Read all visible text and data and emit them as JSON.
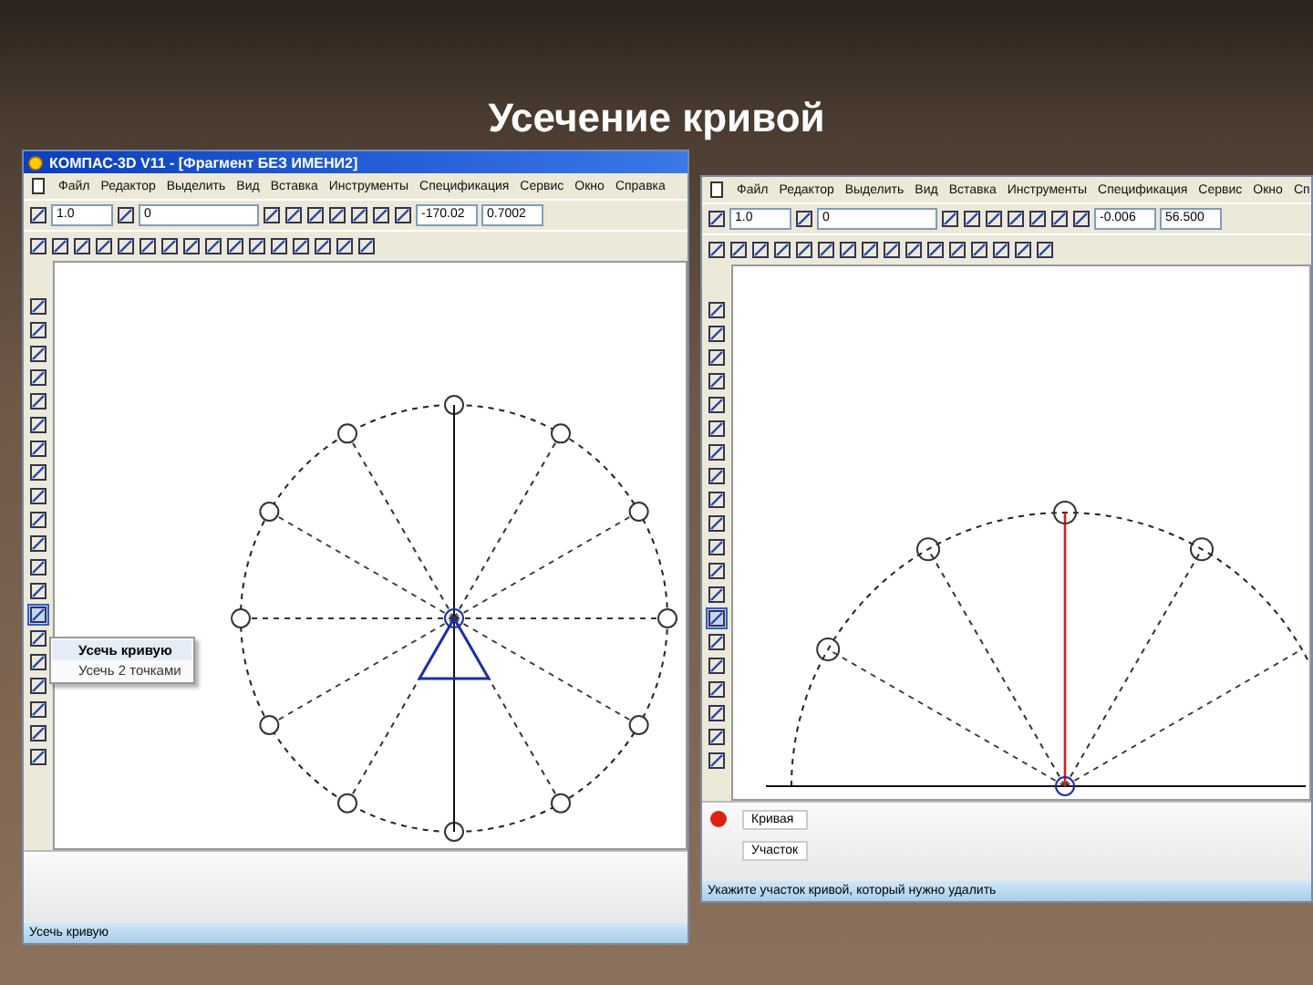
{
  "slide": {
    "title": "Усечение кривой"
  },
  "windows": [
    {
      "kind": "full",
      "title": "КОМПАС-3D V11 - [Фрагмент БЕЗ ИМЕНИ2]",
      "menu": [
        "Файл",
        "Редактор",
        "Выделить",
        "Вид",
        "Вставка",
        "Инструменты",
        "Спецификация",
        "Сервис",
        "Окно",
        "Справка"
      ],
      "fields": [
        "1.0",
        "0",
        "-170.02",
        "0.7002"
      ],
      "popup": [
        {
          "label": "Усечь кривую",
          "selected": true
        },
        {
          "label": "Усечь 2 точками",
          "selected": false
        }
      ],
      "status_bar": "Усечь кривую"
    },
    {
      "kind": "arc",
      "menu": [
        "Файл",
        "Редактор",
        "Выделить",
        "Вид",
        "Вставка",
        "Инструменты",
        "Спецификация",
        "Сервис",
        "Окно",
        "Сп"
      ],
      "fields": [
        "1.0",
        "0",
        "-0.006",
        "56.500"
      ],
      "properties": [
        "Кривая",
        "Участок"
      ],
      "status_bar": "Укажите участок кривой, который нужно удалить"
    }
  ]
}
